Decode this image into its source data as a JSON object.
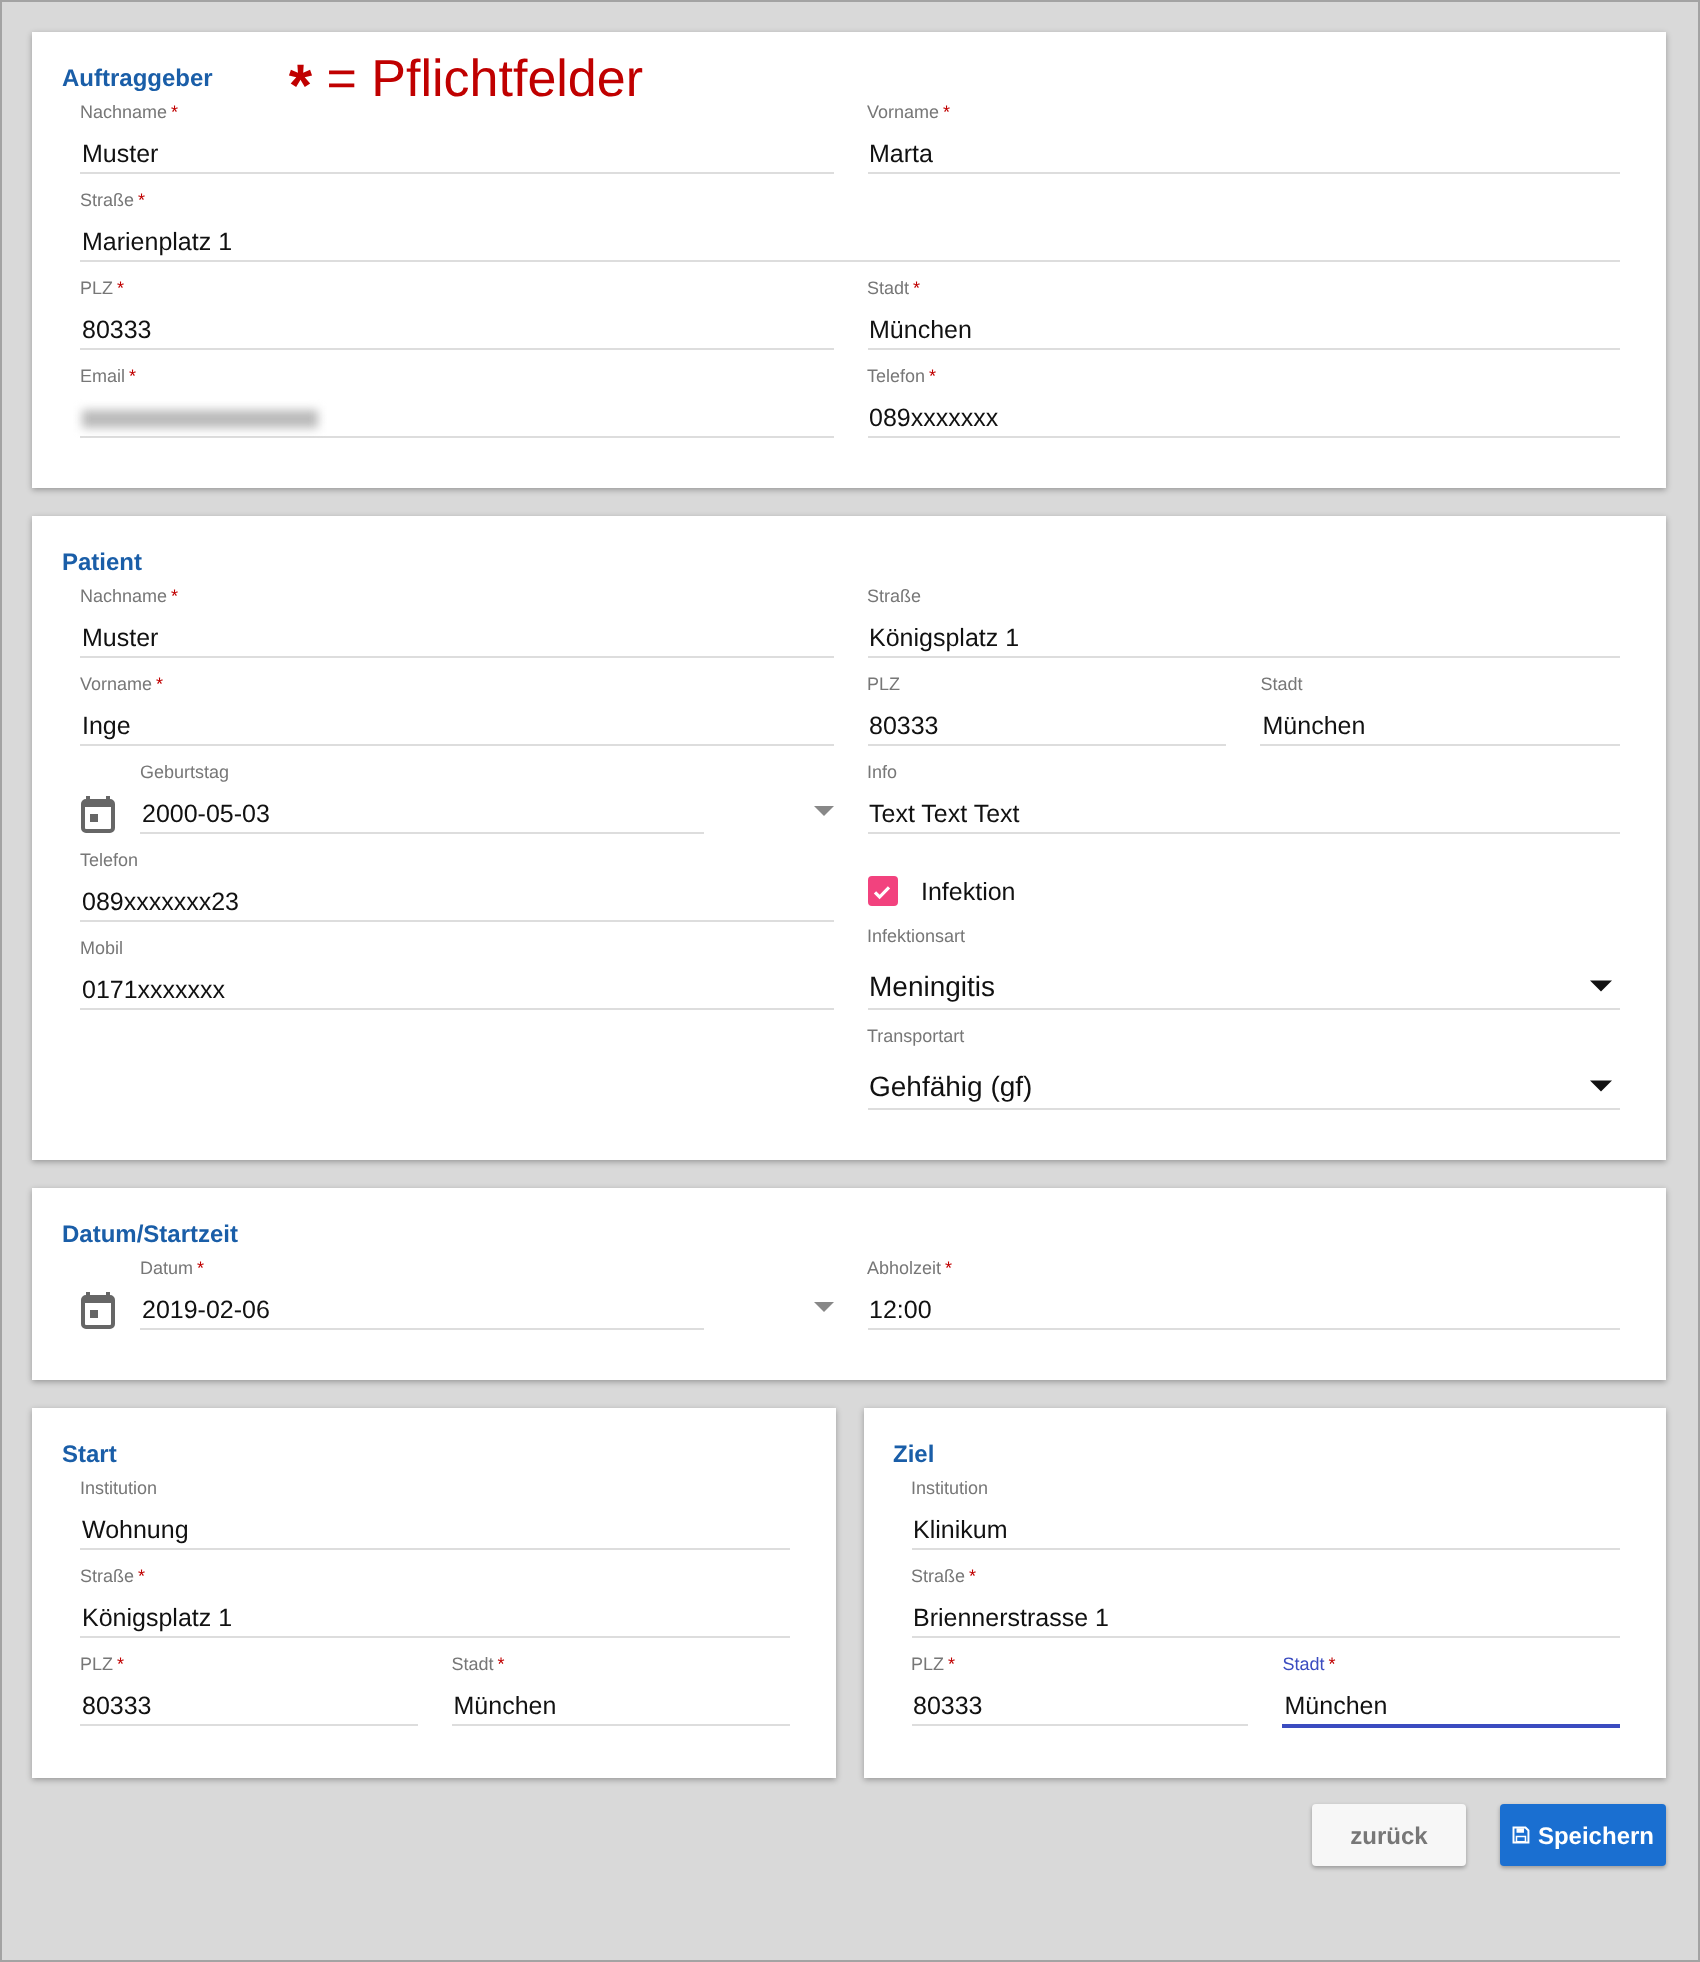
{
  "legend": {
    "mark": "*",
    "text": "= Pflichtfelder"
  },
  "card_rows": [
    {
      "cards": [
        {
          "title": "Auftraggeber",
          "columns": [
            [
              [
                {
                  "kind": "text",
                  "label": "Nachname",
                  "required": true,
                  "value": "Muster",
                  "focused": false
                },
                {
                  "kind": "text",
                  "label": "Vorname",
                  "required": true,
                  "value": "Marta",
                  "focused": false
                }
              ],
              [
                {
                  "kind": "text",
                  "label": "Straße",
                  "required": true,
                  "value": "Marienplatz 1",
                  "focused": false
                }
              ],
              [
                {
                  "kind": "text",
                  "label": "PLZ",
                  "required": true,
                  "value": "80333",
                  "focused": false
                },
                {
                  "kind": "text",
                  "label": "Stadt",
                  "required": true,
                  "value": "München",
                  "focused": false
                }
              ],
              [
                {
                  "kind": "redacted",
                  "label": "Email",
                  "required": true,
                  "focused": false
                },
                {
                  "kind": "text",
                  "label": "Telefon",
                  "required": true,
                  "value": "089xxxxxxx",
                  "focused": false
                }
              ]
            ]
          ]
        }
      ]
    },
    {
      "cards": [
        {
          "title": "Patient",
          "columns": [
            [
              [
                {
                  "kind": "text",
                  "label": "Nachname",
                  "required": true,
                  "value": "Muster",
                  "focused": false
                }
              ],
              [
                {
                  "kind": "text",
                  "label": "Vorname",
                  "required": true,
                  "value": "Inge",
                  "focused": false
                }
              ],
              [
                {
                  "kind": "date",
                  "label": "Geburtstag",
                  "required": false,
                  "value": "2000-05-03",
                  "focused": false
                }
              ],
              [
                {
                  "kind": "text",
                  "label": "Telefon",
                  "required": false,
                  "value": "089xxxxxxx23",
                  "focused": false
                }
              ],
              [
                {
                  "kind": "text",
                  "label": "Mobil",
                  "required": false,
                  "value": "0171xxxxxxx",
                  "focused": false
                }
              ]
            ],
            [
              [
                {
                  "kind": "text",
                  "label": "Straße",
                  "required": false,
                  "value": "Königsplatz 1",
                  "focused": false
                }
              ],
              [
                {
                  "kind": "text",
                  "label": "PLZ",
                  "required": false,
                  "value": "80333",
                  "focused": false
                },
                {
                  "kind": "text",
                  "label": "Stadt",
                  "required": false,
                  "value": "München",
                  "focused": false
                }
              ],
              [
                {
                  "kind": "text",
                  "label": "Info",
                  "required": false,
                  "value": "Text Text Text",
                  "focused": false
                }
              ],
              [
                {
                  "kind": "checkbox",
                  "label": "Infektion",
                  "checked": true
                }
              ],
              [
                {
                  "kind": "select",
                  "label": "Infektionsart",
                  "required": false,
                  "value": "Meningitis",
                  "focused": false
                }
              ],
              [
                {
                  "kind": "select",
                  "label": "Transportart",
                  "required": false,
                  "value": "Gehfähig (gf)",
                  "focused": false
                }
              ]
            ]
          ]
        }
      ]
    },
    {
      "cards": [
        {
          "title": "Datum/Startzeit",
          "columns": [
            [
              [
                {
                  "kind": "date",
                  "label": "Datum",
                  "required": true,
                  "value": "2019-02-06",
                  "focused": false
                },
                {
                  "kind": "text",
                  "label": "Abholzeit",
                  "required": true,
                  "value": "12:00",
                  "focused": false
                }
              ]
            ]
          ]
        }
      ]
    },
    {
      "cards": [
        {
          "title": "Start",
          "columns": [
            [
              [
                {
                  "kind": "text",
                  "label": "Institution",
                  "required": false,
                  "value": "Wohnung",
                  "focused": false
                }
              ],
              [
                {
                  "kind": "text",
                  "label": "Straße",
                  "required": true,
                  "value": "Königsplatz 1",
                  "focused": false
                }
              ],
              [
                {
                  "kind": "text",
                  "label": "PLZ",
                  "required": true,
                  "value": "80333",
                  "focused": false
                },
                {
                  "kind": "text",
                  "label": "Stadt",
                  "required": true,
                  "value": "München",
                  "focused": false
                }
              ]
            ]
          ]
        },
        {
          "title": "Ziel",
          "columns": [
            [
              [
                {
                  "kind": "text",
                  "label": "Institution",
                  "required": false,
                  "value": "Klinikum",
                  "focused": false
                }
              ],
              [
                {
                  "kind": "text",
                  "label": "Straße",
                  "required": true,
                  "value": "Briennerstrasse 1",
                  "focused": false
                }
              ],
              [
                {
                  "kind": "text",
                  "label": "PLZ",
                  "required": true,
                  "value": "80333",
                  "focused": false
                },
                {
                  "kind": "text",
                  "label": "Stadt",
                  "required": true,
                  "value": "München",
                  "focused": true
                }
              ]
            ]
          ]
        }
      ]
    }
  ],
  "buttons": [
    {
      "kind": "secondary",
      "label": "zurück"
    },
    {
      "kind": "primary",
      "label": "Speichern"
    }
  ]
}
